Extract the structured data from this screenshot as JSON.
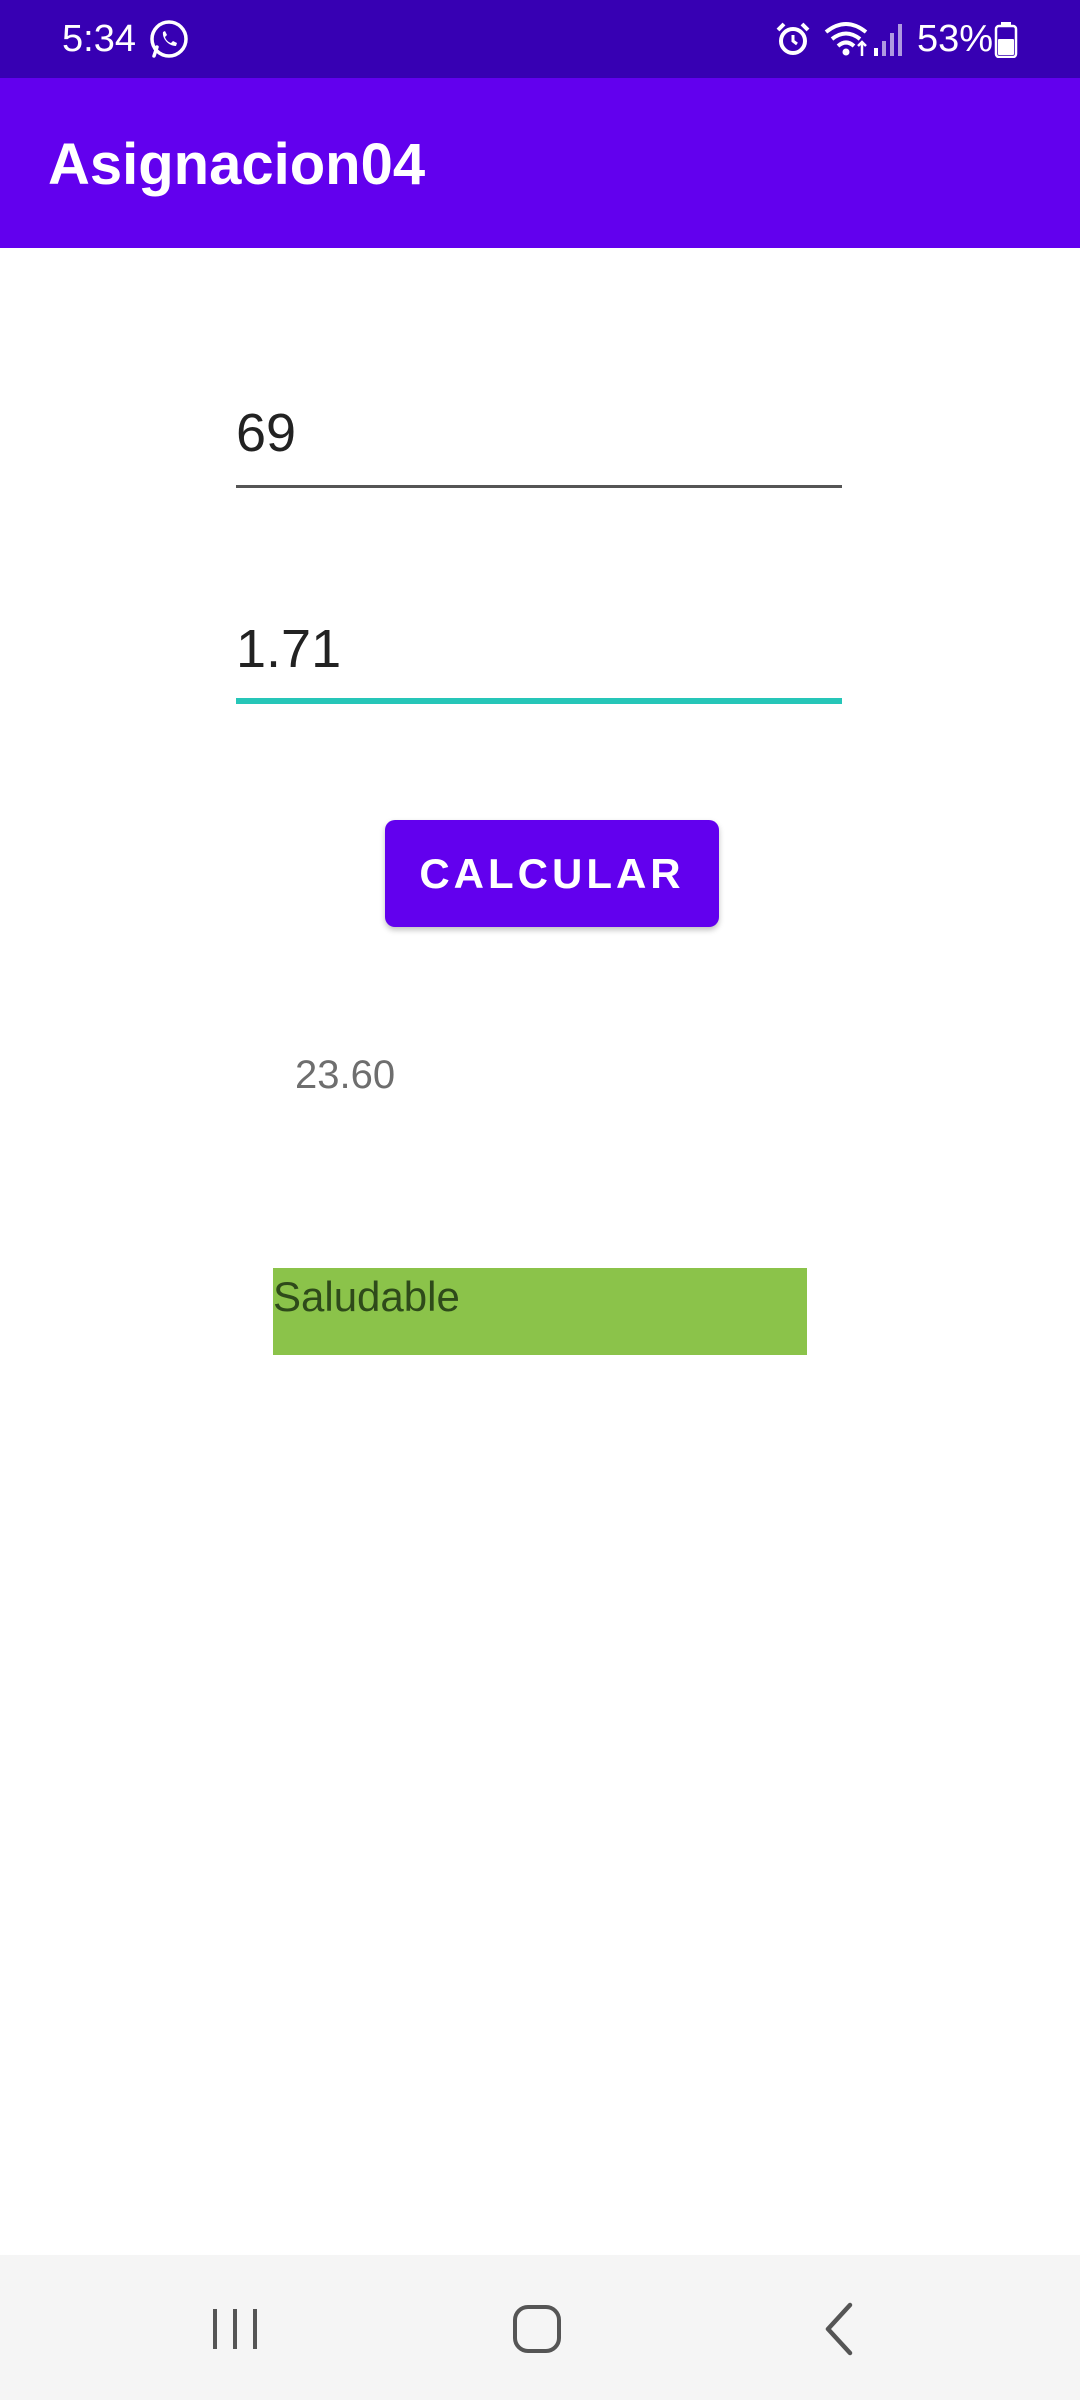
{
  "status_bar": {
    "time": "5:34",
    "battery_text": "53%",
    "icons": [
      "whatsapp-icon",
      "alarm-icon",
      "wifi-icon",
      "signal-icon",
      "battery-icon"
    ]
  },
  "app_bar": {
    "title": "Asignacion04"
  },
  "form": {
    "weight_value": "69",
    "height_value": "1.71",
    "calculate_label": "CALCULAR"
  },
  "result": {
    "bmi_value": "23.60",
    "classification": "Saludable",
    "classification_color": "#8bc34a"
  },
  "nav_bar": {
    "icons": [
      "recents-icon",
      "home-icon",
      "back-icon"
    ]
  },
  "colors": {
    "status_bar": "#3700b3",
    "primary": "#6200ee",
    "accent": "#26c6b8"
  }
}
